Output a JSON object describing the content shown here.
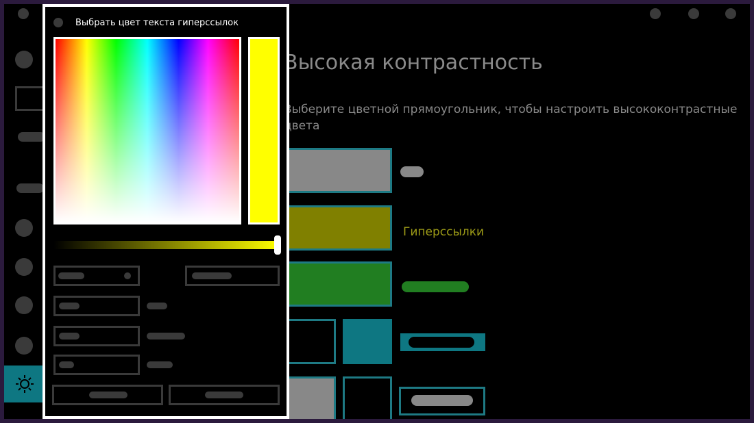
{
  "settings": {
    "title": "Высокая контрастность",
    "description": "Выберите цветной прямоугольник, чтобы настроить высококонтрастные цвета",
    "hyperlinks_label": "Гиперссылки"
  },
  "color_picker": {
    "title": "Выбрать цвет текста гиперссылок",
    "selected_color": "#ffff00",
    "brightness_level": 1.0
  },
  "swatch_colors": {
    "text": "#888888",
    "hyperlinks": "#808000",
    "disabled_text": "#217e21",
    "selected_text_bg": "#0e7782",
    "button_text": "#888888",
    "accent_border": "#1e7a84"
  },
  "icons": {
    "settings": "sun-gear-icon"
  }
}
